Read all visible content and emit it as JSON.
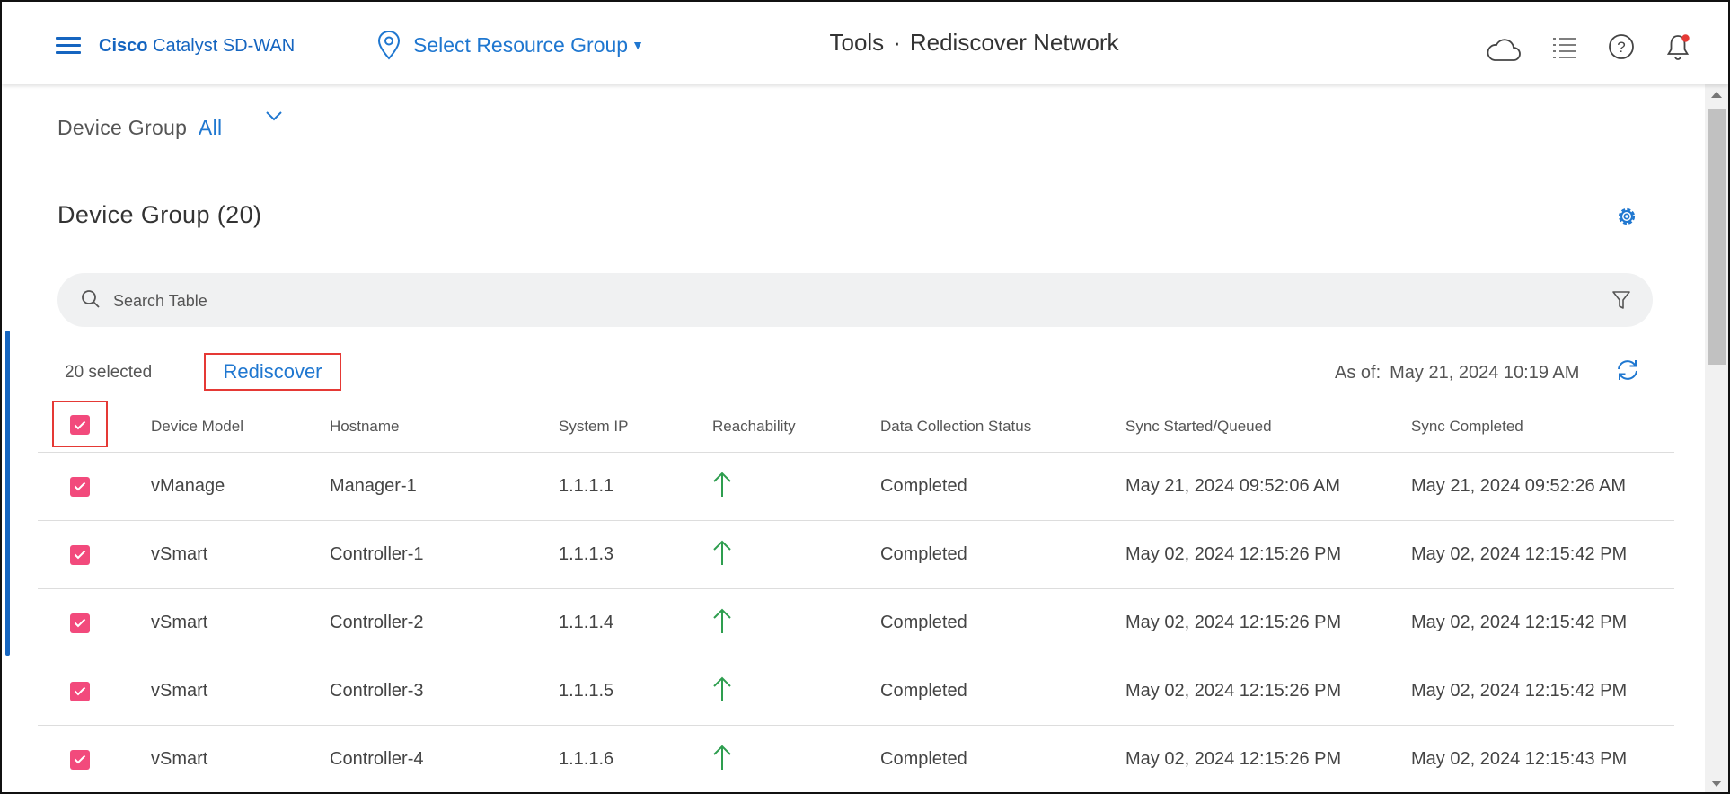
{
  "header": {
    "brand_bold": "Cisco",
    "brand_rest": "Catalyst SD-WAN",
    "resource_group": "Select Resource Group",
    "title_section": "Tools",
    "title_page": "Rediscover Network",
    "notification_color": "#e53935"
  },
  "filter": {
    "label": "Device Group",
    "value": "All"
  },
  "section": {
    "title": "Device Group (20)"
  },
  "search": {
    "placeholder": "Search Table"
  },
  "actions": {
    "selected_text": "20 selected",
    "rediscover_label": "Rediscover",
    "asof_label": "As of:",
    "asof_value": "May 21, 2024 10:19 AM"
  },
  "table": {
    "columns": [
      "Device Model",
      "Hostname",
      "System IP",
      "Reachability",
      "Data Collection Status",
      "Sync Started/Queued",
      "Sync Completed"
    ],
    "rows": [
      {
        "model": "vManage",
        "hostname": "Manager-1",
        "ip": "1.1.1.1",
        "reachability": "up",
        "status": "Completed",
        "started": "May 21, 2024 09:52:06 AM",
        "completed": "May 21, 2024 09:52:26 AM"
      },
      {
        "model": "vSmart",
        "hostname": "Controller-1",
        "ip": "1.1.1.3",
        "reachability": "up",
        "status": "Completed",
        "started": "May 02, 2024 12:15:26 PM",
        "completed": "May 02, 2024 12:15:42 PM"
      },
      {
        "model": "vSmart",
        "hostname": "Controller-2",
        "ip": "1.1.1.4",
        "reachability": "up",
        "status": "Completed",
        "started": "May 02, 2024 12:15:26 PM",
        "completed": "May 02, 2024 12:15:42 PM"
      },
      {
        "model": "vSmart",
        "hostname": "Controller-3",
        "ip": "1.1.1.5",
        "reachability": "up",
        "status": "Completed",
        "started": "May 02, 2024 12:15:26 PM",
        "completed": "May 02, 2024 12:15:42 PM"
      },
      {
        "model": "vSmart",
        "hostname": "Controller-4",
        "ip": "1.1.1.6",
        "reachability": "up",
        "status": "Completed",
        "started": "May 02, 2024 12:15:26 PM",
        "completed": "May 02, 2024 12:15:43 PM"
      }
    ]
  },
  "colors": {
    "accent": "#1f77d0",
    "checkbox": "#f24a7c",
    "reachable": "#2e9e4f",
    "highlight": "#e53935"
  }
}
